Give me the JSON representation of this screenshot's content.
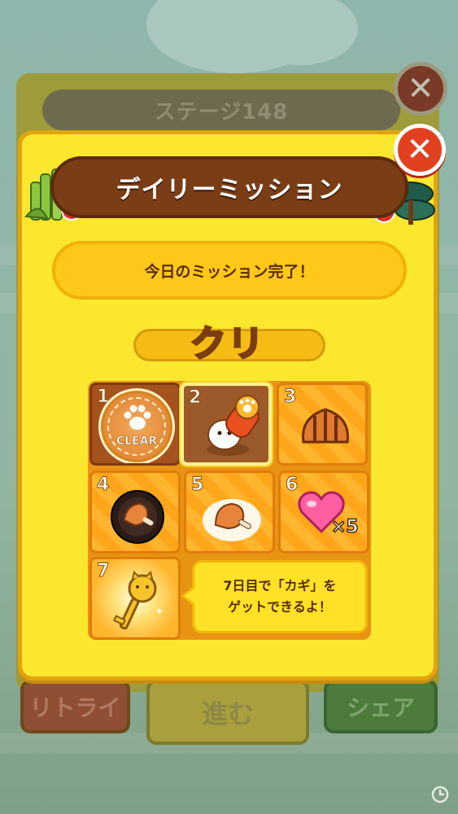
{
  "background": {
    "stage_title": "ステージ148",
    "buttons": {
      "retry": "リトライ",
      "next": "進む",
      "share": "シェア"
    }
  },
  "popup": {
    "title": "デイリーミッション",
    "close_label": "✕",
    "status": "今日のミッション完了！",
    "clear_label": "クリア!"
  },
  "days": [
    {
      "num": "1",
      "state": "cleared",
      "stamp": "CLEAR",
      "reward": "paw-stamp"
    },
    {
      "num": "2",
      "state": "today",
      "reward": "hammer-character"
    },
    {
      "num": "3",
      "state": "locked",
      "reward": "meat-food"
    },
    {
      "num": "4",
      "state": "locked",
      "reward": "meat-on-plate"
    },
    {
      "num": "5",
      "state": "locked",
      "reward": "meat-food"
    },
    {
      "num": "6",
      "state": "locked",
      "reward": "heart",
      "count": "×5"
    },
    {
      "num": "7",
      "state": "locked",
      "reward": "key"
    }
  ],
  "speech": {
    "line1": "7日目で「カギ」を",
    "line2": "ゲットできるよ！"
  },
  "colors": {
    "popup": "#fbe72e",
    "header": "#7a3d16",
    "close": "#e2411f",
    "cell": "#ffb52e"
  }
}
